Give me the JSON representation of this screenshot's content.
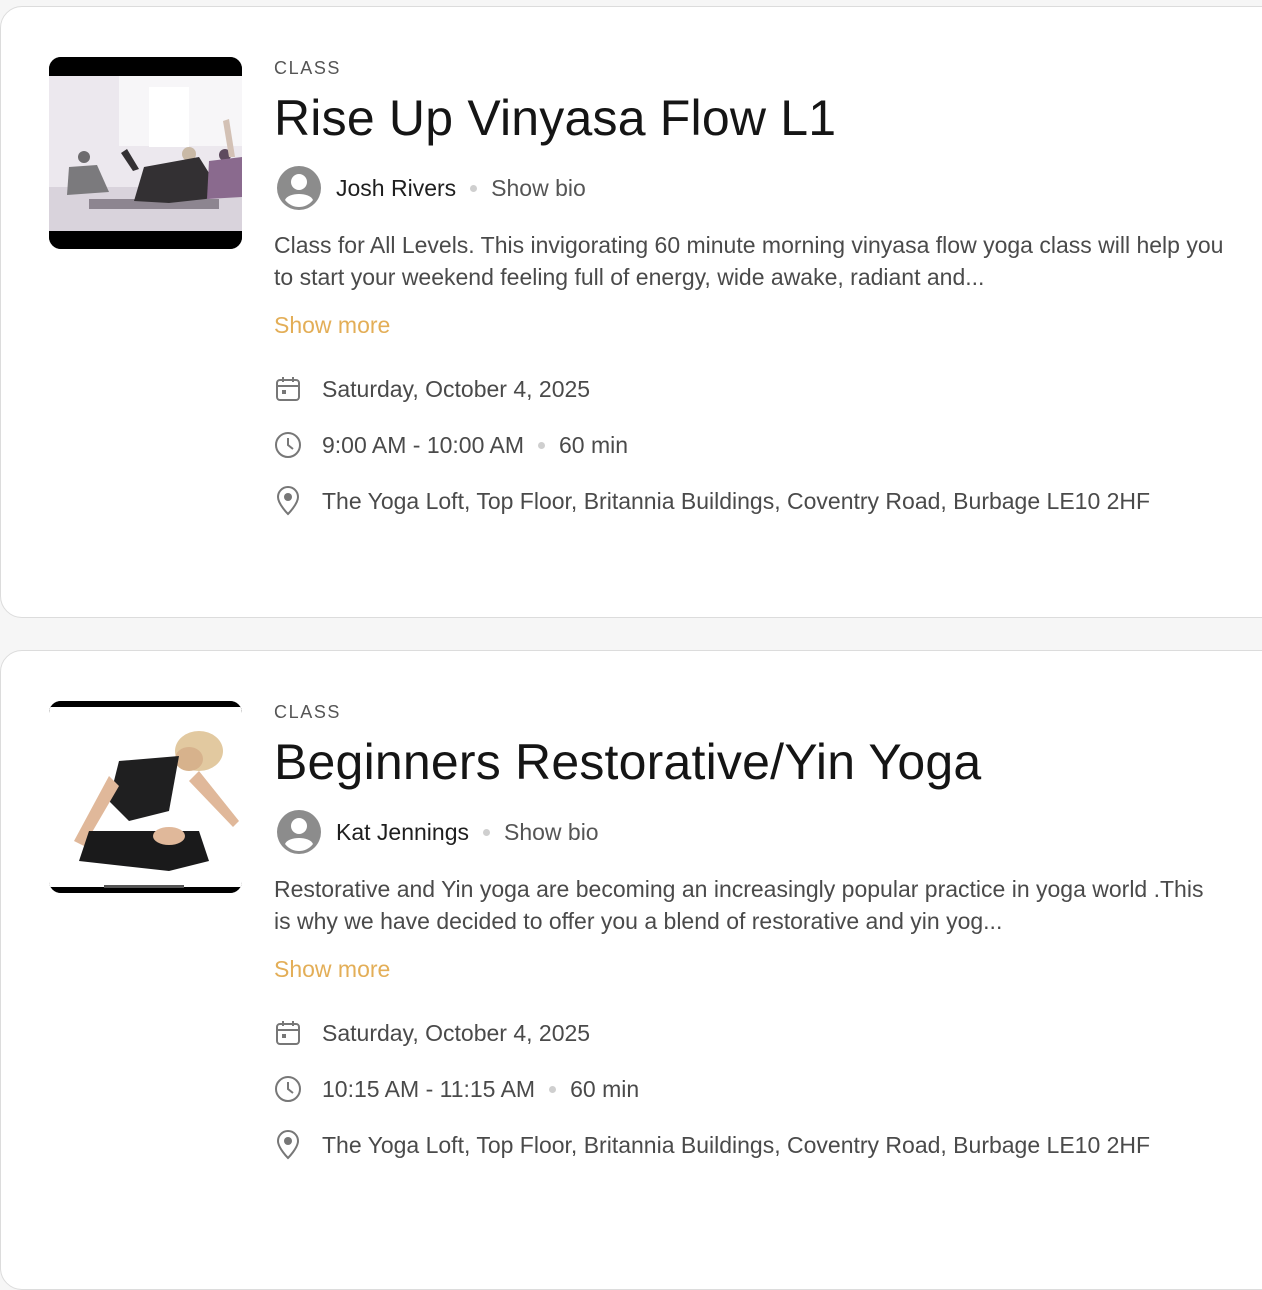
{
  "colors": {
    "accent": "#e3ae57",
    "text": "#1c1c1c",
    "muted": "#4a4a4a"
  },
  "classes": [
    {
      "kicker": "CLASS",
      "title": "Rise Up Vinyasa Flow L1",
      "thumbnail_icon": "yoga-studio-photo",
      "instructor": {
        "name": "Josh Rivers",
        "bio_link": "Show bio",
        "avatar_icon": "user-avatar-icon"
      },
      "description": "Class for All Levels. This invigorating 60 minute morning vinyasa flow yoga class will help you to start your weekend feeling full of energy, wide awake, radiant and...",
      "show_more": "Show more",
      "date": "Saturday, October 4, 2025",
      "time": "9:00 AM - 10:00 AM",
      "duration": "60 min",
      "location": "The Yoga Loft, Top Floor, Britannia Buildings, Coventry Road, Burbage LE10 2HF"
    },
    {
      "kicker": "CLASS",
      "title": "Beginners Restorative/Yin Yoga",
      "thumbnail_icon": "yoga-pose-photo",
      "instructor": {
        "name": "Kat Jennings",
        "bio_link": "Show bio",
        "avatar_icon": "user-avatar-icon"
      },
      "description": "Restorative and Yin yoga are becoming an increasingly popular practice in yoga world .This is why we have decided to offer you a blend of restorative and yin yog...",
      "show_more": "Show more",
      "date": "Saturday, October 4, 2025",
      "time": "10:15 AM - 11:15 AM",
      "duration": "60 min",
      "location": "The Yoga Loft, Top Floor, Britannia Buildings, Coventry Road, Burbage LE10 2HF"
    }
  ]
}
